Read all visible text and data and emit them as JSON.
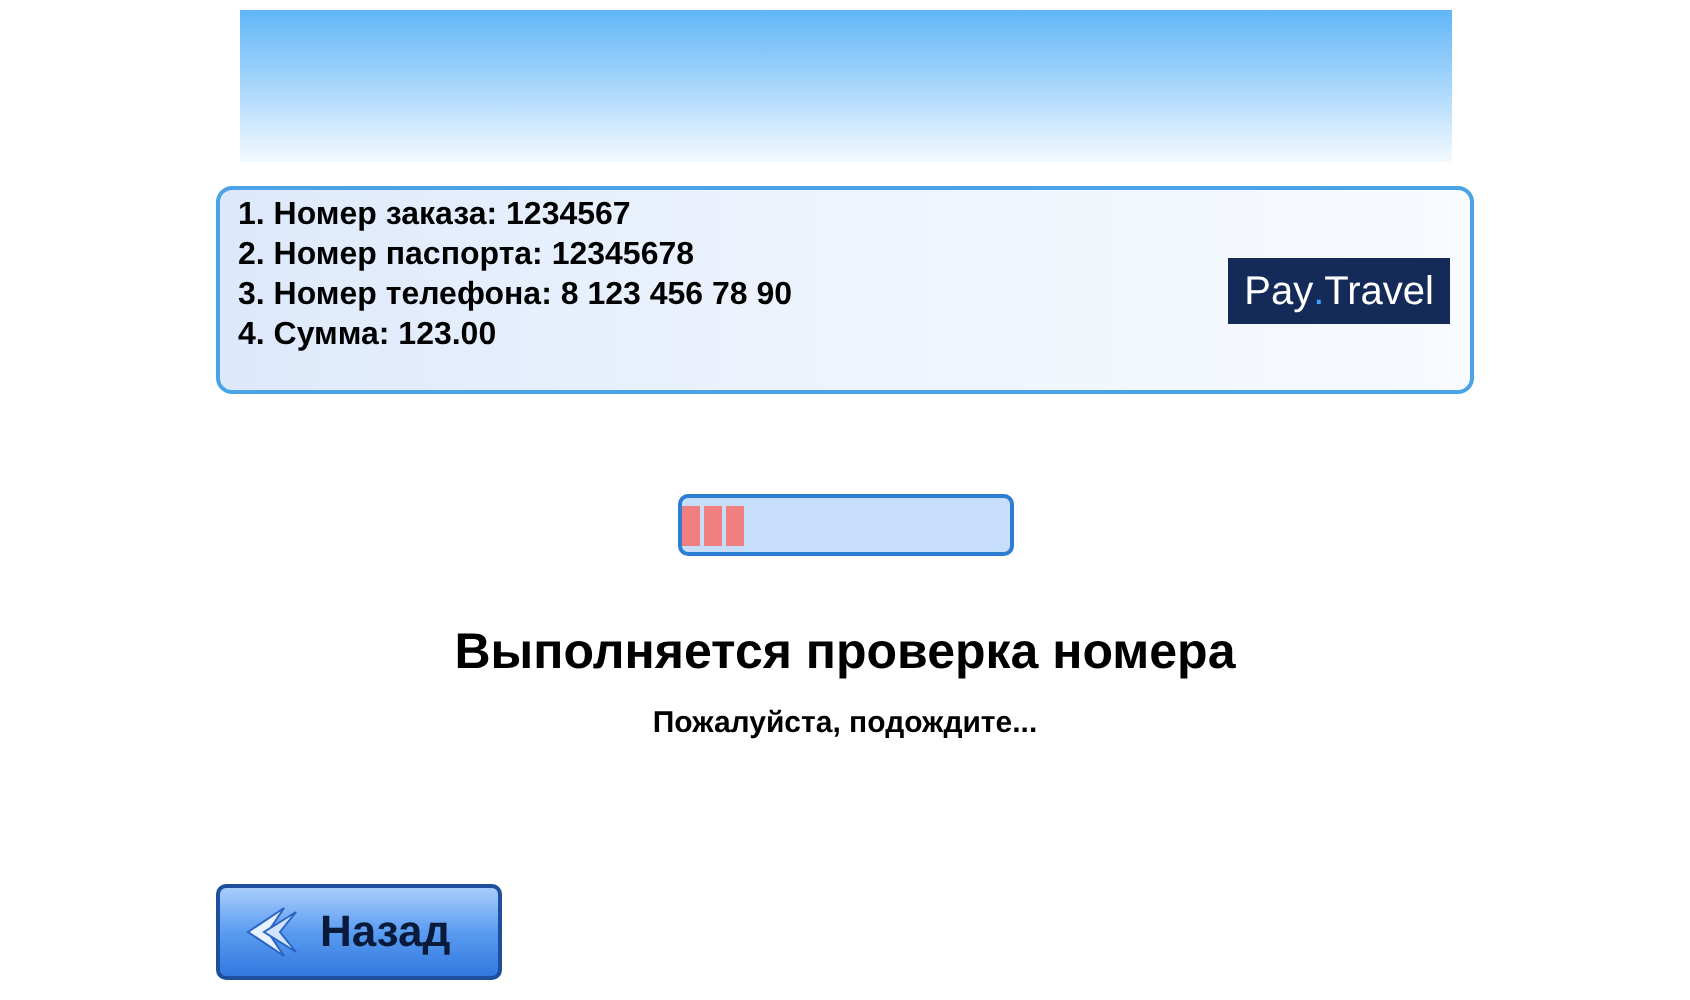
{
  "info_lines": [
    "1. Номер заказа: 1234567",
    "2. Номер паспорта: 12345678",
    "3. Номер телефона: 8 123 456 78 90",
    "4. Сумма: 123.00"
  ],
  "logo": {
    "before": "Pay",
    "dot": ".",
    "after": "Travel"
  },
  "progress": {
    "level": 0.2
  },
  "title": "Выполняется проверка номера",
  "subtitle": "Пожалуйста, подождите...",
  "back_button": {
    "label": "Назад"
  }
}
